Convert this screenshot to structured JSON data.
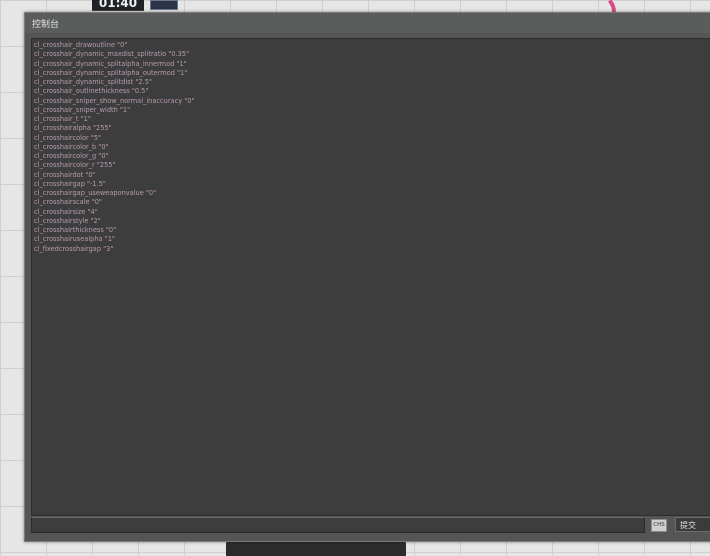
{
  "hud": {
    "timer": "01:40"
  },
  "console": {
    "title": "控制台",
    "lines": [
      "cl_crosshair_drawoutline \"0\"",
      "cl_crosshair_dynamic_maxdist_splitratio \"0.35\"",
      "cl_crosshair_dynamic_splitalpha_innermod \"1\"",
      "cl_crosshair_dynamic_splitalpha_outermod \"1\"",
      "cl_crosshair_dynamic_splitdist \"2.5\"",
      "cl_crosshair_outlinethickness \"0.5\"",
      "cl_crosshair_sniper_show_normal_inaccuracy \"0\"",
      "cl_crosshair_sniper_width \"1\"",
      "cl_crosshair_t \"1\"",
      "cl_crosshairalpha \"255\"",
      "cl_crosshaircolor \"5\"",
      "cl_crosshaircolor_b \"0\"",
      "cl_crosshaircolor_g \"0\"",
      "cl_crosshaircolor_r \"255\"",
      "cl_crosshairdot \"0\"",
      "cl_crosshairgap \"-1.5\"",
      "cl_crosshairgap_useweaponvalue \"0\"",
      "cl_crosshairscale \"0\"",
      "cl_crosshairsize \"4\"",
      "cl_crosshairstyle \"2\"",
      "cl_crosshairthickness \"0\"",
      "cl_crosshairusealpha \"1\"",
      "cl_fixedcrosshairgap \"3\""
    ],
    "input_value": "",
    "ime_label": "CHS",
    "submit_label": "提交"
  },
  "colors": {
    "window_bg": "#545555",
    "log_bg": "#3d3d3d",
    "log_text": "#b89bb0",
    "accent_pink": "#d64d8a"
  }
}
